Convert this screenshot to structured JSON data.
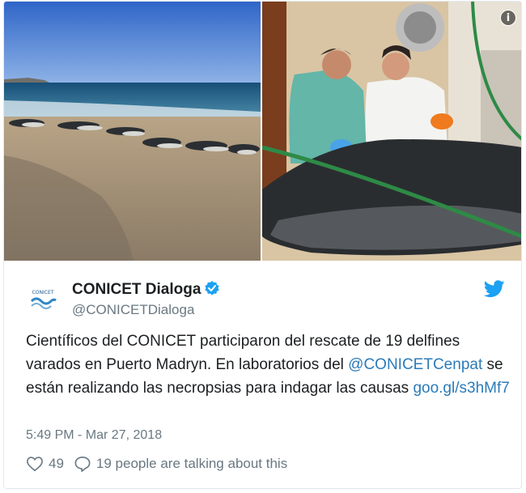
{
  "media": {
    "info_icon": "i"
  },
  "author": {
    "logo_text": "CONICET",
    "name": "CONICET Dialoga",
    "handle": "@CONICETDialoga"
  },
  "tweet": {
    "text_part1": "Científicos del CONICET participaron del rescate de 19 delfines varados en Puerto Madryn. En laboratorios del ",
    "mention": "@CONICETCenpat",
    "text_part2": " se están realizando las necropsias para indagar las causas ",
    "url": "goo.gl/s3hMf7",
    "timestamp": "5:49 PM - Mar 27, 2018"
  },
  "actions": {
    "likes": "49",
    "replies": "19 people are talking about this"
  },
  "colors": {
    "link": "#2b7bb9",
    "verified": "#1da1f2",
    "secondary_text": "#697882"
  },
  "icons": [
    "info-icon",
    "verified-icon",
    "twitter-bird-icon",
    "heart-icon",
    "reply-icon"
  ]
}
